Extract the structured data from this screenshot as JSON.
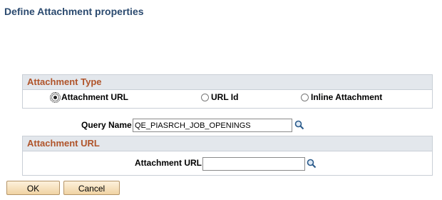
{
  "page": {
    "title": "Define Attachment properties"
  },
  "attachment_type": {
    "header": "Attachment Type",
    "options": [
      {
        "label": "Attachment URL",
        "selected": true
      },
      {
        "label": "URL Id",
        "selected": false
      },
      {
        "label": "Inline Attachment",
        "selected": false
      }
    ]
  },
  "query": {
    "label": "Query Name",
    "value": "QE_PIASRCH_JOB_OPENINGS",
    "lookup_icon": "search-icon"
  },
  "attachment_url": {
    "header": "Attachment URL",
    "label": "Attachment URL",
    "value": "",
    "lookup_icon": "search-icon"
  },
  "buttons": {
    "ok": "OK",
    "cancel": "Cancel"
  }
}
